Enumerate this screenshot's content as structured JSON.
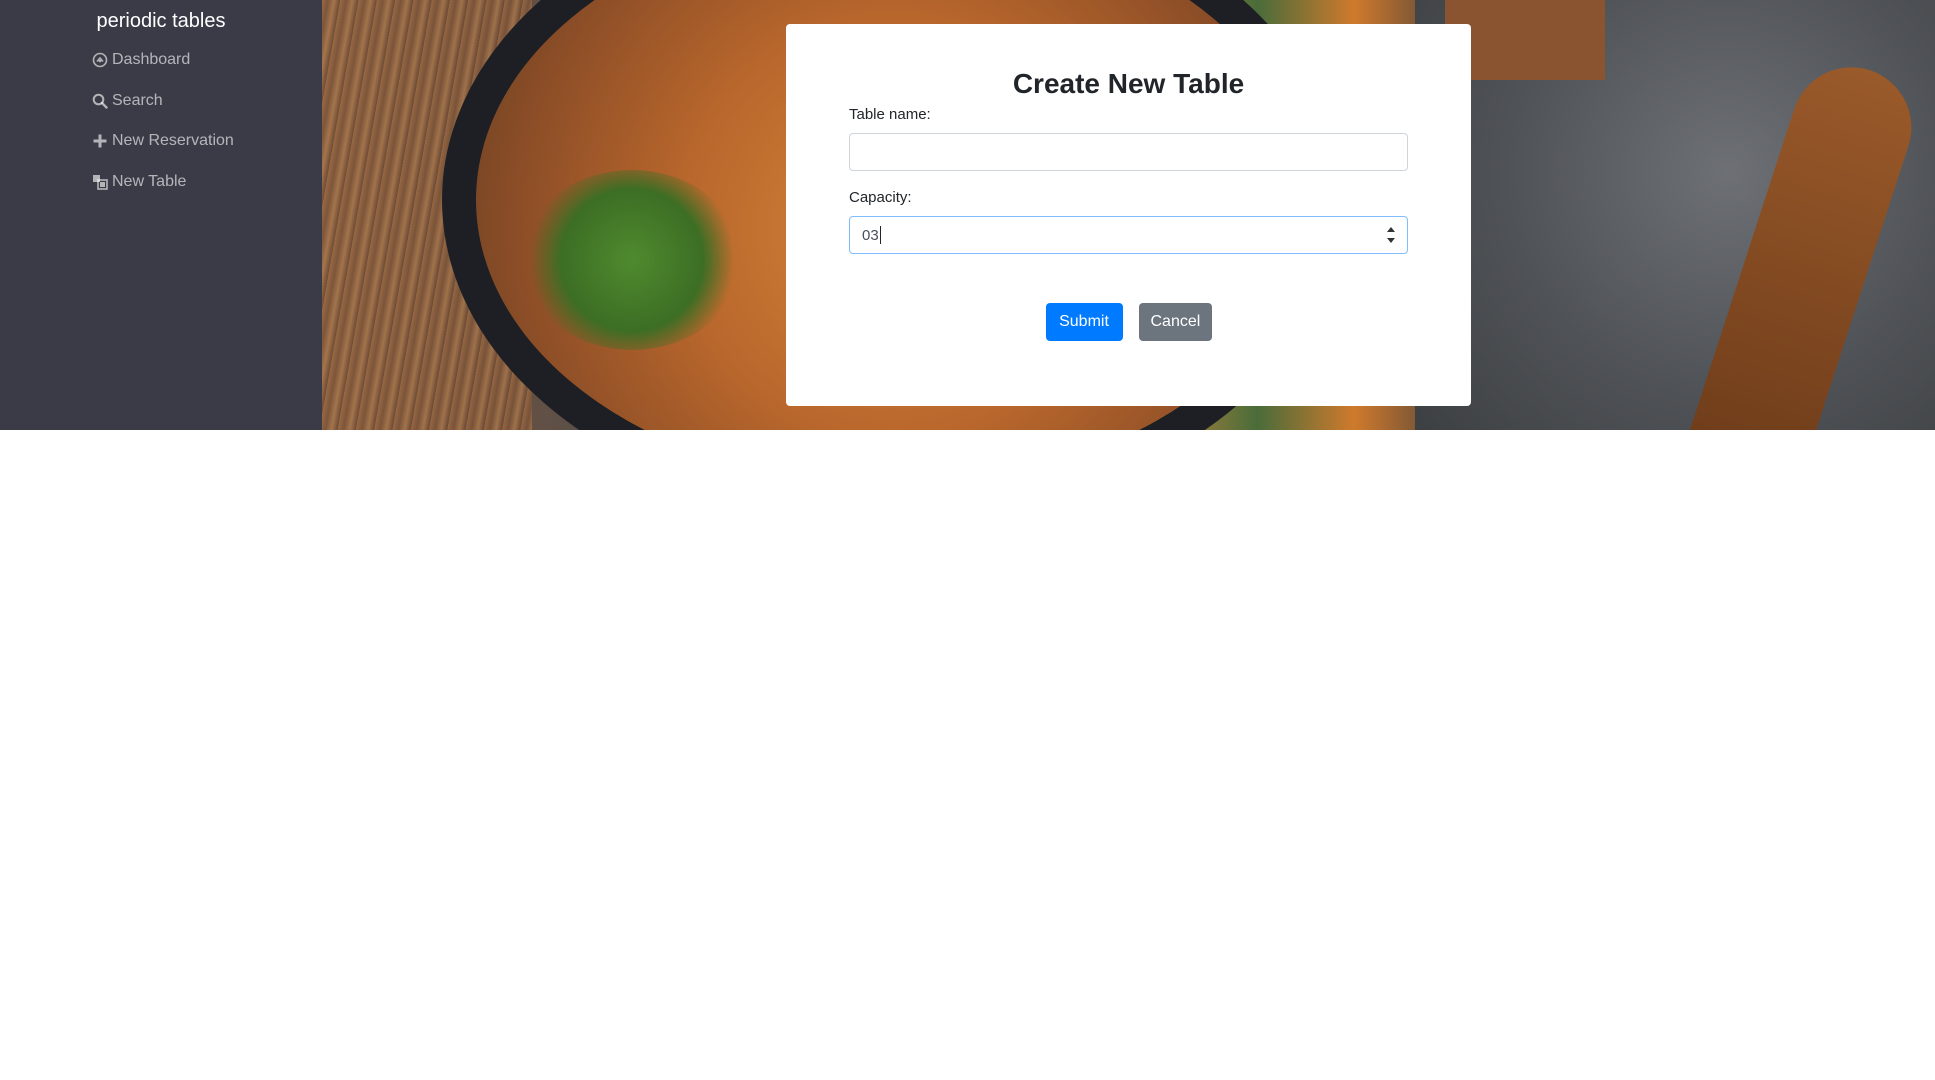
{
  "sidebar": {
    "brand": "periodic tables",
    "items": [
      {
        "label": "Dashboard",
        "icon": "dashboard-icon"
      },
      {
        "label": "Search",
        "icon": "search-icon"
      },
      {
        "label": "New Reservation",
        "icon": "plus-icon"
      },
      {
        "label": "New Table",
        "icon": "table-icon"
      }
    ]
  },
  "form": {
    "title": "Create New Table",
    "table_name_label": "Table name:",
    "table_name_value": "",
    "capacity_label": "Capacity:",
    "capacity_value": "03",
    "submit_label": "Submit",
    "cancel_label": "Cancel"
  },
  "colors": {
    "sidebar_bg": "#3a3b46",
    "primary": "#007bff",
    "secondary": "#6c757d"
  }
}
